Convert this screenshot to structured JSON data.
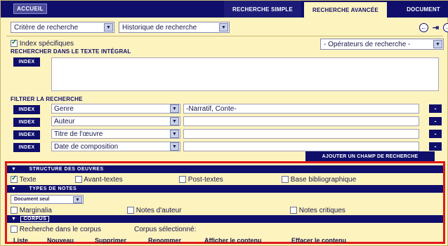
{
  "topbar": {
    "accueil": "ACCUEIL",
    "tabs": [
      "RECHERCHE SIMPLE",
      "RECHERCHE AVANCÉE",
      "DOCUMENT"
    ]
  },
  "toolbar": {
    "criteria_select": "Critère de recherche",
    "history_select": "Historique de recherche",
    "operators_select": "- Opérateurs de recherche -"
  },
  "fulltext": {
    "specific_index_label": "Index spécifiques",
    "heading": "RECHERCHER DANS LE TEXTE INTÉGRAL",
    "index_button": "INDEX"
  },
  "filter": {
    "heading": "FILTRER LA RECHERCHE",
    "rows": [
      {
        "index": "INDEX",
        "field": "Genre",
        "value": "-Narratif, Conte-",
        "remove": "-"
      },
      {
        "index": "INDEX",
        "field": "Auteur",
        "value": "",
        "remove": "-"
      },
      {
        "index": "INDEX",
        "field": "Titre de l'œuvre",
        "value": "",
        "remove": "-"
      },
      {
        "index": "INDEX",
        "field": "Date de composition",
        "value": "",
        "remove": "-"
      }
    ],
    "add_field_button": "AJOUTER UN CHAMP DE RECHERCHE"
  },
  "structure": {
    "heading": "STRUCTURE DES OEUVRES",
    "options": [
      {
        "label": "Texte",
        "checked": true
      },
      {
        "label": "Avant-textes",
        "checked": false
      },
      {
        "label": "Post-textes",
        "checked": false
      },
      {
        "label": "Base bibliographique",
        "checked": false
      }
    ]
  },
  "notes": {
    "heading": "TYPES DE NOTES",
    "doc_select": "Document seul",
    "options": [
      {
        "label": "Marginalia",
        "checked": false
      },
      {
        "label": "Notes d'auteur",
        "checked": false
      },
      {
        "label": "Notes critiques",
        "checked": false
      }
    ]
  },
  "corpus": {
    "heading": "CORPUS",
    "search_in_corpus": "Recherche dans le corpus",
    "selected_label": "Corpus sélectionné:",
    "actions": [
      "Liste",
      "Nouveau",
      "Supprimer",
      "Renommer",
      "Afficher le contenu",
      "Effacer le contenu"
    ]
  },
  "colors": {
    "navy": "#0f0f6b",
    "panel": "#fdf3bf",
    "highlight": "#e01818"
  }
}
